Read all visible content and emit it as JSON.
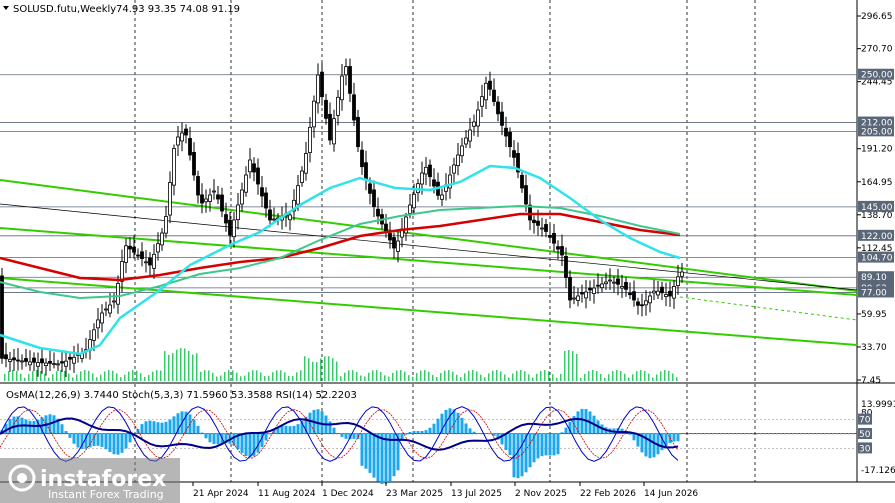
{
  "header": {
    "symbol": "SOLUSD.futu,Weekly",
    "ohlc": "74.93 93.35 74.08 91.19",
    "osma": "OsMA(12,26,9) 3.7440",
    "stoch": "Stoch(5,3,3) 71.5960 53.3588",
    "rsi": "RSI(14) 52.2203"
  },
  "price_axis": {
    "ticks": [
      "296.65",
      "270.70",
      "244.45",
      "191.20",
      "164.95",
      "138.70",
      "112.45",
      "59.95",
      "33.70",
      "7.45"
    ],
    "price_labels": [
      {
        "text": "250.00",
        "color": "#5a6778"
      },
      {
        "text": "212.00",
        "color": "#5a6778"
      },
      {
        "text": "205.00",
        "color": "#5a6778"
      },
      {
        "text": "145.00",
        "color": "#5a6778"
      },
      {
        "text": "122.00",
        "color": "#5a6778"
      },
      {
        "text": "104.70",
        "color": "#5a6778"
      },
      {
        "text": "89.10",
        "color": "#5a6778"
      },
      {
        "text": "80.63",
        "color": "#5a6778"
      },
      {
        "text": "77.00",
        "color": "#5a6778"
      }
    ]
  },
  "indicator_axis": {
    "ticks": [
      "13.9991",
      "80",
      "0",
      "-17.1267"
    ],
    "labels": [
      {
        "text": "70",
        "color": "#5a6778"
      },
      {
        "text": "50",
        "color": "#5a6778"
      },
      {
        "text": "30",
        "color": "#5a6778"
      }
    ]
  },
  "time_axis": [
    "21 Apr 2024",
    "11 Aug 2024",
    "1 Dec 2024",
    "23 Mar 2025",
    "13 Jul 2025",
    "2 Nov 2025",
    "22 Feb 2026",
    "14 Jun 2026"
  ],
  "watermark": {
    "brand": "instaforex",
    "tagline": "Instant Forex Trading"
  },
  "colors": {
    "candles": "#000000",
    "ema_red": "#d60000",
    "ma_cyan": "#2fe3ea",
    "ma_green": "#3cc88c",
    "channel": "#33cc00",
    "histogram_main": "#1aa7ec",
    "stoch_main": "#0000cc",
    "stoch_signal": "#cc0000",
    "grid": "#000000",
    "label_bg": "#5a6778"
  },
  "chart_data": {
    "type": "line",
    "title": "SOLUSD.futu,Weekly",
    "xlabel": "",
    "ylabel": "",
    "ylim": [
      7.45,
      296.65
    ],
    "grid": true,
    "x": [
      "21 Apr 2024",
      "11 Aug 2024",
      "1 Dec 2024",
      "23 Mar 2025",
      "13 Jul 2025",
      "2 Nov 2025",
      "22 Feb 2026",
      "14 Jun 2026"
    ],
    "series": [
      {
        "name": "Close",
        "values": [
          148,
          155,
          237,
          130,
          190,
          138,
          82,
          91.19
        ]
      },
      {
        "name": "",
        "values": [
          110,
          128,
          148,
          140,
          138,
          142,
          125,
          122
        ]
      },
      {
        "name": "",
        "values": [
          108,
          135,
          190,
          165,
          195,
          175,
          110,
          104.7
        ]
      }
    ],
    "last_ohlc": {
      "open": 74.93,
      "high": 93.35,
      "low": 74.08,
      "close": 91.19
    },
    "horizontal_levels": [
      250,
      212,
      205,
      145,
      122,
      104.7,
      89.1,
      80.63,
      77
    ],
    "indicators": [
      {
        "name": "OsMA(12,26,9)",
        "value": 3.744
      },
      {
        "name": "Stoch(5,3,3)",
        "values": [
          71.596,
          53.3588
        ]
      },
      {
        "name": "RSI(14)",
        "value": 52.2203
      }
    ]
  }
}
